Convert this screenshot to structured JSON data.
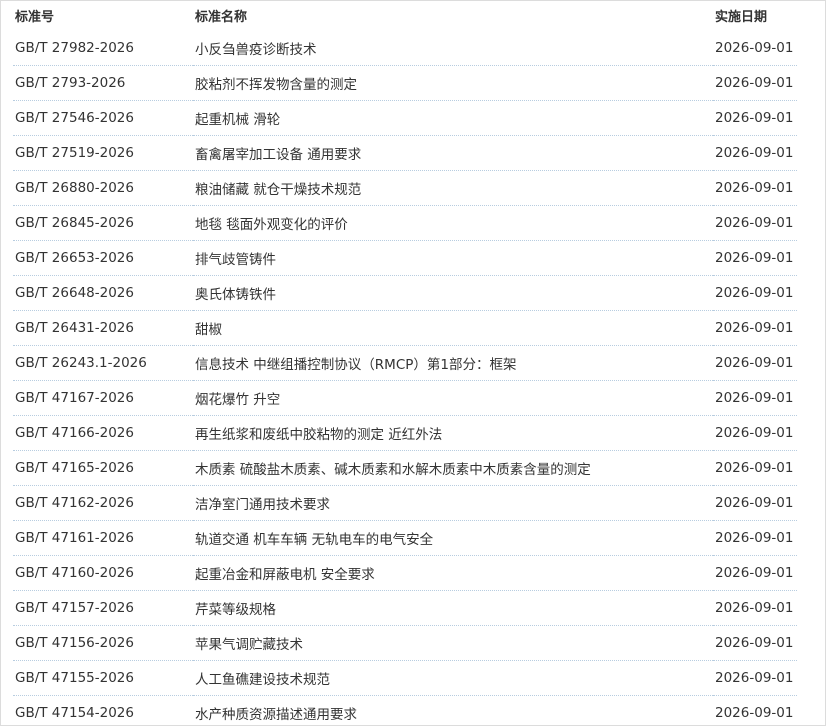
{
  "table": {
    "headers": {
      "number": "标准号",
      "name": "标准名称",
      "date": "实施日期"
    },
    "rows": [
      {
        "number": "GB/T 27982-2026",
        "name": "小反刍兽疫诊断技术",
        "date": "2026-09-01"
      },
      {
        "number": "GB/T 2793-2026",
        "name": "胶粘剂不挥发物含量的测定",
        "date": "2026-09-01"
      },
      {
        "number": "GB/T 27546-2026",
        "name": "起重机械 滑轮",
        "date": "2026-09-01"
      },
      {
        "number": "GB/T 27519-2026",
        "name": "畜禽屠宰加工设备 通用要求",
        "date": "2026-09-01"
      },
      {
        "number": "GB/T 26880-2026",
        "name": "粮油储藏 就仓干燥技术规范",
        "date": "2026-09-01"
      },
      {
        "number": "GB/T 26845-2026",
        "name": "地毯 毯面外观变化的评价",
        "date": "2026-09-01"
      },
      {
        "number": "GB/T 26653-2026",
        "name": "排气歧管铸件",
        "date": "2026-09-01"
      },
      {
        "number": "GB/T 26648-2026",
        "name": "奥氏体铸铁件",
        "date": "2026-09-01"
      },
      {
        "number": "GB/T 26431-2026",
        "name": "甜椒",
        "date": "2026-09-01"
      },
      {
        "number": "GB/T 26243.1-2026",
        "name": "信息技术 中继组播控制协议（RMCP）第1部分：框架",
        "date": "2026-09-01"
      },
      {
        "number": "GB/T 47167-2026",
        "name": "烟花爆竹 升空",
        "date": "2026-09-01"
      },
      {
        "number": "GB/T 47166-2026",
        "name": "再生纸浆和废纸中胶粘物的测定 近红外法",
        "date": "2026-09-01"
      },
      {
        "number": "GB/T 47165-2026",
        "name": "木质素 硫酸盐木质素、碱木质素和水解木质素中木质素含量的测定",
        "date": "2026-09-01"
      },
      {
        "number": "GB/T 47162-2026",
        "name": "洁净室门通用技术要求",
        "date": "2026-09-01"
      },
      {
        "number": "GB/T 47161-2026",
        "name": "轨道交通 机车车辆 无轨电车的电气安全",
        "date": "2026-09-01"
      },
      {
        "number": "GB/T 47160-2026",
        "name": "起重冶金和屏蔽电机 安全要求",
        "date": "2026-09-01"
      },
      {
        "number": "GB/T 47157-2026",
        "name": "芹菜等级规格",
        "date": "2026-09-01"
      },
      {
        "number": "GB/T 47156-2026",
        "name": "苹果气调贮藏技术",
        "date": "2026-09-01"
      },
      {
        "number": "GB/T 47155-2026",
        "name": "人工鱼礁建设技术规范",
        "date": "2026-09-01"
      },
      {
        "number": "GB/T 47154-2026",
        "name": "水产种质资源描述通用要求",
        "date": "2026-09-01"
      }
    ]
  }
}
